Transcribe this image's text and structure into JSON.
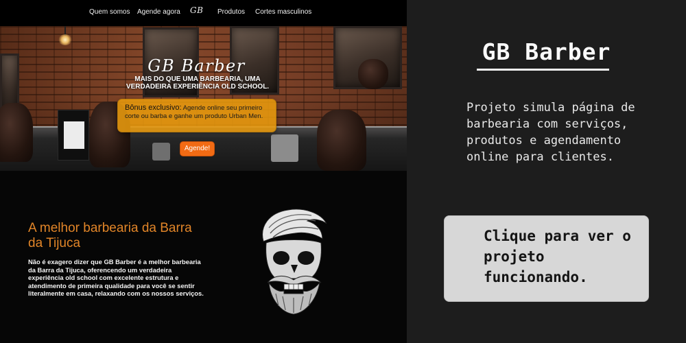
{
  "site_preview": {
    "nav": {
      "items": [
        "Quem somos",
        "Agende agora",
        "Produtos",
        "Cortes masculinos"
      ],
      "logo": "GB"
    },
    "hero": {
      "title": "GB Barber",
      "subtitle": "MAIS DO QUE UMA BARBEARIA, UMA VERDADEIRA EXPERIÊNCIA OLD SCHOOL.",
      "bonus_label": "Bônus exclusivo:",
      "bonus_text": "Agende online seu primeiro corte ou barba e ganhe um produto Urban Men.",
      "cta_label": "Agende!",
      "accent_color": "#f26b14"
    },
    "about": {
      "title": "A melhor barbearia da Barra da Tijuca",
      "text": "Não é exagero dizer que GB Barber é a melhor barbearia da Barra da Tijuca, oferencendo um verdadeira experiência old school com excelente estrutura e atendimento de primeira qualidade para você se sentir literalmente em casa, relaxando com os nossos serviços.",
      "title_color": "#e18528"
    }
  },
  "project_card": {
    "title": "GB Barber",
    "description": "Projeto simula página de barbearia com serviços, produtos e agendamento online para clientes.",
    "button_label": "Clique para ver o projeto funcionando."
  },
  "icons": {
    "skull": "bearded-skull-icon",
    "lamp": "pendant-lamp-icon"
  }
}
